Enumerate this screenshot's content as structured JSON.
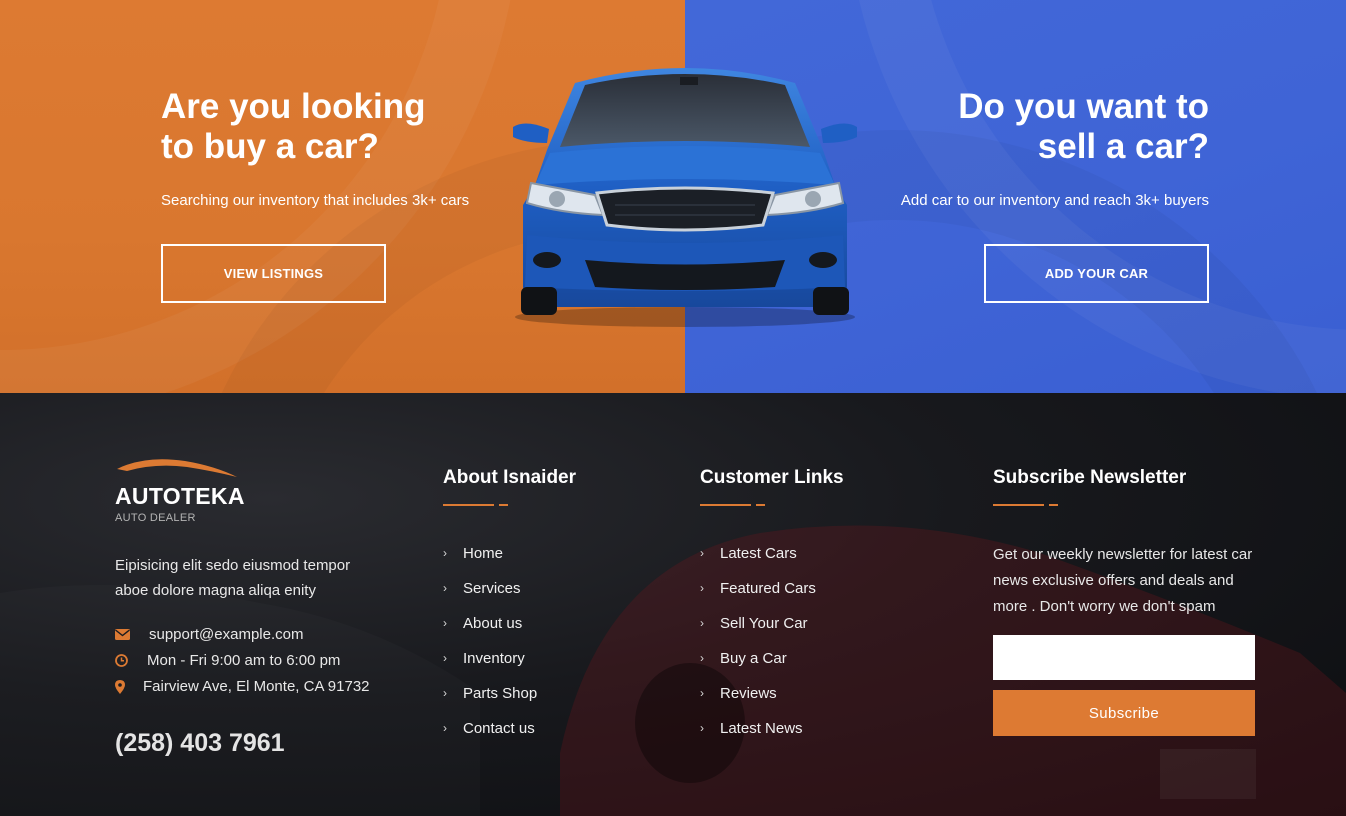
{
  "hero": {
    "buy": {
      "title": "Are you looking\nto buy a car?",
      "subtitle": "Searching our inventory that includes 3k+ cars",
      "button_label": "VIEW LISTINGS"
    },
    "sell": {
      "title": "Do you want to\nsell a car?",
      "subtitle": "Add car to our inventory and reach 3k+ buyers",
      "button_label": "ADD YOUR CAR"
    }
  },
  "footer": {
    "brand": {
      "name": "AUTOTEKA",
      "tagline": "AUTO DEALER",
      "description": "Eipisicing elit sedo eiusmod tempor aboe dolore magna aliqa enity"
    },
    "contact": {
      "email": "support@example.com",
      "hours": "Mon - Fri 9:00 am to 6:00 pm",
      "address": "Fairview Ave, El Monte, CA 91732",
      "phone": "(258) 403 7961"
    },
    "about": {
      "title": "About Isnaider",
      "links": [
        "Home",
        "Services",
        "About us",
        "Inventory",
        "Parts Shop",
        "Contact us"
      ]
    },
    "customer": {
      "title": "Customer Links",
      "links": [
        "Latest Cars",
        "Featured Cars",
        "Sell Your Car",
        "Buy a Car",
        "Reviews",
        "Latest News"
      ]
    },
    "newsletter": {
      "title": "Subscribe Newsletter",
      "text": "Get our weekly newsletter for latest car news exclusive offers and deals and more . Don't worry we don't spam",
      "input_value": "",
      "button_label": "Subscribe"
    }
  },
  "icons": {
    "email": "envelope-icon",
    "hours": "clock-icon",
    "address": "map-pin-icon",
    "link": "chevron-right-icon"
  },
  "colors": {
    "orange": "#dc7a33",
    "blue": "#4066d7",
    "footer_bg": "#131418"
  }
}
